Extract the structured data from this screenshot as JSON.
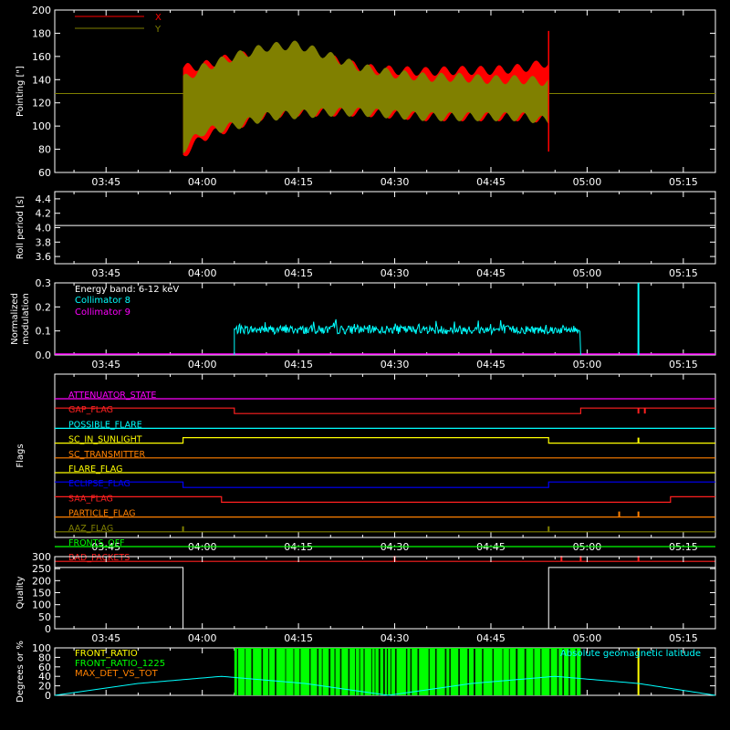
{
  "time_ticks": [
    "03:45",
    "04:00",
    "04:15",
    "04:30",
    "04:45",
    "05:00",
    "05:15"
  ],
  "chart_data": [
    {
      "id": "pointing",
      "type": "line",
      "ylabel": "Pointing [\"]",
      "ylim": [
        60,
        200
      ],
      "yticks": [
        60,
        80,
        100,
        120,
        140,
        160,
        180,
        200
      ],
      "xrange": [
        "03:37",
        "05:20"
      ],
      "data_window": [
        "03:57",
        "04:54"
      ],
      "baseline": 128,
      "series": [
        {
          "name": "X",
          "color": "#ff0000",
          "x": [
            "03:57",
            "04:00",
            "04:05",
            "04:10",
            "04:15",
            "04:20",
            "04:25",
            "04:30",
            "04:35",
            "04:40",
            "04:45",
            "04:50",
            "04:54"
          ],
          "upper": [
            150,
            152,
            160,
            162,
            162,
            158,
            150,
            148,
            147,
            148,
            148,
            150,
            155
          ],
          "lower": [
            75,
            90,
            100,
            110,
            112,
            112,
            112,
            110,
            108,
            108,
            108,
            108,
            106
          ]
        },
        {
          "name": "Y",
          "color": "#808000",
          "x": [
            "03:57",
            "04:00",
            "04:05",
            "04:10",
            "04:15",
            "04:20",
            "04:25",
            "04:30",
            "04:35",
            "04:40",
            "04:45",
            "04:50",
            "04:54"
          ],
          "upper": [
            140,
            150,
            160,
            168,
            170,
            160,
            150,
            145,
            142,
            142,
            140,
            140,
            138
          ],
          "lower": [
            80,
            95,
            100,
            108,
            110,
            112,
            112,
            110,
            108,
            108,
            108,
            108,
            104
          ]
        }
      ]
    },
    {
      "id": "roll_period",
      "type": "line",
      "ylabel": "Roll period [s]",
      "ylim": [
        3.5,
        4.5
      ],
      "yticks": [
        3.6,
        3.8,
        4.0,
        4.2,
        4.4
      ],
      "series": [
        {
          "name": "",
          "color": "#ffffff",
          "x": [
            "03:37",
            "05:20"
          ],
          "y": [
            4.03,
            4.03
          ]
        }
      ]
    },
    {
      "id": "modulation",
      "type": "line",
      "ylabel": "Normalized modulation",
      "ylim": [
        0,
        0.3
      ],
      "yticks": [
        0.0,
        0.1,
        0.2,
        0.3
      ],
      "annotation": "Energy band: 6-12 keV",
      "series": [
        {
          "name": "Collimator 8",
          "color": "#00ffff",
          "x": [
            "04:05",
            "04:59"
          ],
          "mean": 0.105,
          "noise": 0.018,
          "spike": {
            "x": "05:08",
            "y": 0.3
          }
        },
        {
          "name": "Collimator 9",
          "color": "#ff00ff",
          "x": [
            "03:37",
            "05:20"
          ],
          "y": [
            0.0,
            0.0
          ]
        }
      ]
    },
    {
      "id": "flags",
      "type": "line",
      "ylabel": "Flags",
      "flags": [
        {
          "name": "ATTENUATOR_STATE",
          "color": "#ff00ff",
          "segments": [
            [
              "03:37",
              0,
              "05:20",
              0
            ]
          ]
        },
        {
          "name": "GAP_FLAG",
          "color": "#ff2020",
          "segments": [
            [
              "03:37",
              1,
              "04:05",
              1,
              "04:05",
              0,
              "04:59",
              0,
              "04:59",
              1,
              "05:20",
              1
            ]
          ],
          "spikes": [
            "05:08",
            "05:09"
          ]
        },
        {
          "name": "POSSIBLE_FLARE",
          "color": "#00ffff",
          "segments": [
            [
              "03:37",
              0,
              "05:20",
              0
            ]
          ]
        },
        {
          "name": "SC_IN_SUNLIGHT",
          "color": "#ffff00",
          "segments": [
            [
              "03:37",
              0,
              "03:57",
              0,
              "03:57",
              1,
              "04:54",
              1,
              "04:54",
              0,
              "05:20",
              0
            ]
          ],
          "spikes": [
            "05:08"
          ]
        },
        {
          "name": "SC_TRANSMITTER",
          "color": "#ff8000",
          "segments": [
            [
              "03:37",
              0,
              "05:20",
              0
            ]
          ]
        },
        {
          "name": "FLARE_FLAG",
          "color": "#ffff00",
          "segments": [
            [
              "03:37",
              0,
              "05:20",
              0
            ]
          ]
        },
        {
          "name": "ECLIPSE_FLAG",
          "color": "#0000ff",
          "segments": [
            [
              "03:37",
              1,
              "03:57",
              1,
              "03:57",
              0,
              "04:54",
              0,
              "04:54",
              1,
              "05:20",
              1
            ]
          ]
        },
        {
          "name": "SAA_FLAG",
          "color": "#ff2020",
          "segments": [
            [
              "03:37",
              1,
              "04:03",
              1,
              "04:03",
              0,
              "05:13",
              0,
              "05:13",
              1,
              "05:20",
              1
            ]
          ]
        },
        {
          "name": "PARTICLE_FLAG",
          "color": "#ff8000",
          "segments": [
            [
              "03:37",
              0,
              "05:20",
              0
            ]
          ],
          "spikes": [
            "05:05",
            "05:08"
          ]
        },
        {
          "name": "AAZ_FLAG",
          "color": "#808000",
          "segments": [
            [
              "03:37",
              0,
              "05:20",
              0
            ]
          ],
          "spikes": [
            "03:57",
            "04:54"
          ]
        },
        {
          "name": "FRONTS_OFF",
          "color": "#00ff00",
          "segments": [
            [
              "03:37",
              0,
              "05:20",
              0
            ]
          ]
        },
        {
          "name": "BAD_PACKETS",
          "color": "#ff2020",
          "segments": [
            [
              "03:37",
              0,
              "05:20",
              0
            ]
          ],
          "spikes": [
            "04:30",
            "04:56",
            "04:59",
            "05:08"
          ]
        }
      ]
    },
    {
      "id": "quality",
      "type": "line",
      "ylabel": "Quality",
      "ylim": [
        0,
        300
      ],
      "yticks": [
        0,
        50,
        100,
        150,
        200,
        250,
        300
      ],
      "series": [
        {
          "name": "",
          "color": "#ffffff",
          "x": [
            "03:37",
            "03:57",
            "03:57",
            "04:54",
            "04:54",
            "05:20"
          ],
          "y": [
            255,
            255,
            0,
            0,
            255,
            255
          ]
        }
      ]
    },
    {
      "id": "front_ratio",
      "type": "line",
      "ylabel": "Degrees or %",
      "ylim": [
        0,
        100
      ],
      "yticks": [
        0,
        20,
        40,
        60,
        80,
        100
      ],
      "annotation": "Absolute geomagnetic latitude",
      "series": [
        {
          "name": "FRONT_RATIO",
          "color": "#ffff00",
          "spike": {
            "x": "05:08",
            "y": 100
          }
        },
        {
          "name": "FRONT_RATIO_1225",
          "color": "#00ff00",
          "x": [
            "04:05",
            "04:59"
          ],
          "y_high": 100
        },
        {
          "name": "MAX_DET_VS_TOT",
          "color": "#ff8000"
        },
        {
          "name": "Absolute geomagnetic latitude",
          "color": "#00ffff",
          "x": [
            "03:37",
            "03:50",
            "04:03",
            "04:16",
            "04:29",
            "04:42",
            "04:55",
            "05:08",
            "05:20"
          ],
          "y": [
            0,
            25,
            40,
            25,
            0,
            25,
            40,
            25,
            0
          ]
        }
      ]
    }
  ]
}
